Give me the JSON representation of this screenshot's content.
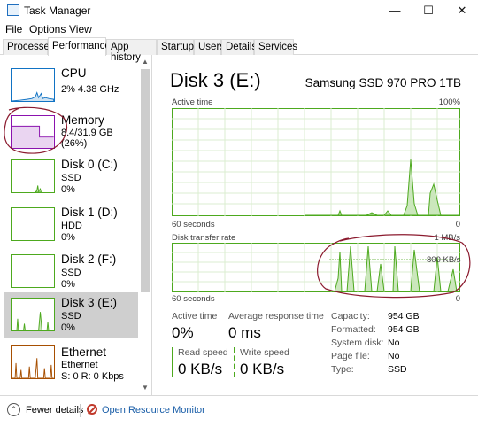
{
  "window": {
    "title": "Task Manager",
    "controls": {
      "minimize": "—",
      "maximize": "☐",
      "close": "✕"
    }
  },
  "menu": [
    "File",
    "Options",
    "View"
  ],
  "tabs": [
    "Processes",
    "Performance",
    "App history",
    "Startup",
    "Users",
    "Details",
    "Services"
  ],
  "active_tab": "Performance",
  "sidebar": {
    "items": [
      {
        "title": "CPU",
        "line1": "2% 4.38 GHz",
        "line2": ""
      },
      {
        "title": "Memory",
        "line1": "8.4/31.9 GB (26%)",
        "line2": ""
      },
      {
        "title": "Disk 0 (C:)",
        "line1": "SSD",
        "line2": "0%"
      },
      {
        "title": "Disk 1 (D:)",
        "line1": "HDD",
        "line2": "0%"
      },
      {
        "title": "Disk 2 (F:)",
        "line1": "SSD",
        "line2": "0%"
      },
      {
        "title": "Disk 3 (E:)",
        "line1": "SSD",
        "line2": "0%"
      },
      {
        "title": "Ethernet",
        "line1": "Ethernet",
        "line2": "S: 0 R: 0 Kbps"
      }
    ],
    "scroll_up": "▲",
    "scroll_down": "▼"
  },
  "detail": {
    "title": "Disk 3 (E:)",
    "model": "Samsung SSD 970 PRO 1TB",
    "graph1": {
      "label": "Active time",
      "max": "100%",
      "time": "60 seconds",
      "min": "0"
    },
    "graph2": {
      "label": "Disk transfer rate",
      "max": "1 MB/s",
      "mid": "800 KB/s",
      "time": "60 seconds",
      "min": "0"
    },
    "active_time_label": "Active time",
    "active_time_value": "0%",
    "avg_response_label": "Average response time",
    "avg_response_value": "0 ms",
    "read_label": "Read speed",
    "read_value": "0 KB/s",
    "write_label": "Write speed",
    "write_value": "0 KB/s",
    "properties": [
      {
        "key": "Capacity:",
        "value": "954 GB"
      },
      {
        "key": "Formatted:",
        "value": "954 GB"
      },
      {
        "key": "System disk:",
        "value": "No"
      },
      {
        "key": "Page file:",
        "value": "No"
      },
      {
        "key": "Type:",
        "value": "SSD"
      }
    ]
  },
  "footer": {
    "fewer_details": "Fewer details",
    "open_resource_monitor": "Open Resource Monitor"
  },
  "colors": {
    "disk_green": "#4da91e",
    "memory_purple": "#8b12ae",
    "cpu_blue": "#1173c4",
    "ethernet_orange": "#a74f01",
    "annotation_red": "#8b1a2e"
  }
}
